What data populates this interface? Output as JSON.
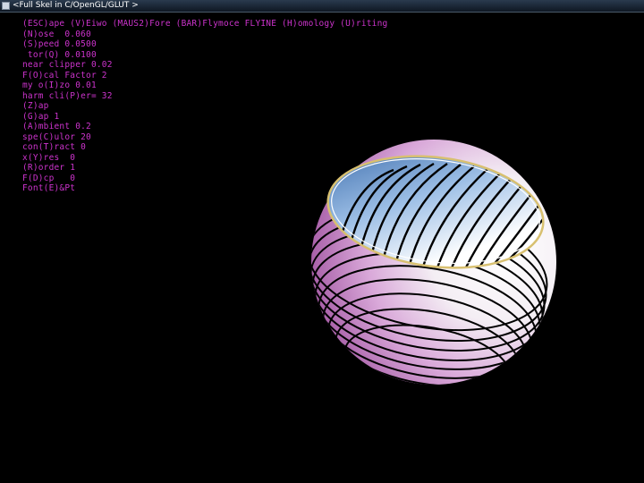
{
  "window": {
    "title": "<Full Skel in C/OpenGL/GLUT >"
  },
  "hud": {
    "lines": [
      "(ESC)ape (V)Eiwo (MAUS2)Fore (BAR)Flymoce FLYINE (H)omology (U)riting",
      "(N)ose  0.060",
      "(S)peed 0.0500",
      " tor(Q) 0.0100",
      "near clipper 0.02",
      "F(O)cal Factor 2",
      "my o(I)zo 0.01",
      "harm cli(P)er= 32",
      "(Z)ap",
      "(G)ap 1",
      "(A)mbient 0.2",
      "spe(C)ulor 20",
      "con(T)ract 0",
      "x(Y)res  0",
      "(R)order 1",
      "F(D)cp   0",
      "Font(E)&Pt"
    ]
  },
  "scene": {
    "object": "striped sphere with opening",
    "colors": {
      "background": "#000000",
      "hud_text": "#cc33cc",
      "shell_shadow": "#b060b0",
      "shell_light": "#ffffff",
      "interior": "#6a94c8",
      "stripe": "#000000",
      "rim": "#d8c070"
    }
  }
}
